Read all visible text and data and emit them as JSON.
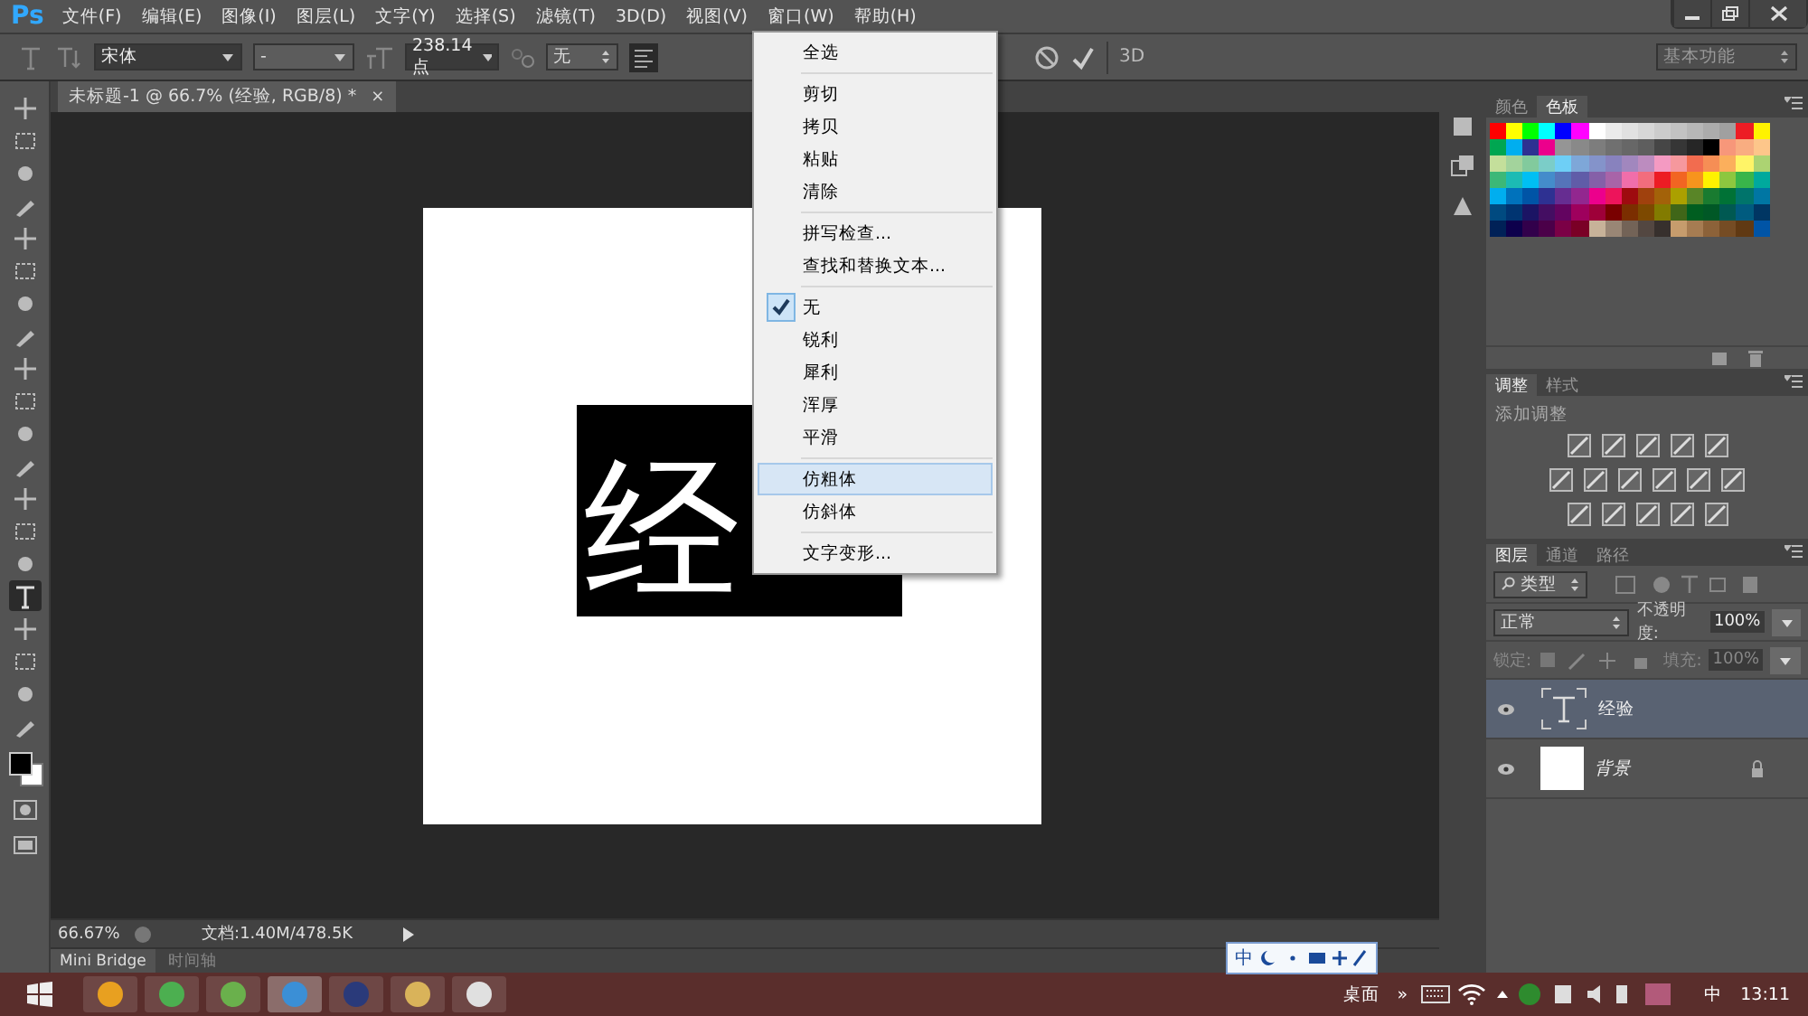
{
  "menubar": {
    "logo": "Ps",
    "items": [
      "文件(F)",
      "编辑(E)",
      "图像(I)",
      "图层(L)",
      "文字(Y)",
      "选择(S)",
      "滤镜(T)",
      "3D(D)",
      "视图(V)",
      "窗口(W)",
      "帮助(H)"
    ]
  },
  "options": {
    "font": "宋体",
    "style": "-",
    "size": "238.14 点",
    "antialias": "无",
    "mode_3d": "3D",
    "workspace": "基本功能"
  },
  "tools": [
    {
      "selected": false
    },
    {
      "selected": false
    },
    {
      "selected": false
    },
    {
      "selected": false
    },
    {
      "selected": false
    },
    {
      "selected": false
    },
    {
      "selected": false
    },
    {
      "selected": false
    },
    {
      "selected": false
    },
    {
      "selected": false
    },
    {
      "selected": false
    },
    {
      "selected": false
    },
    {
      "selected": false
    },
    {
      "selected": false
    },
    {
      "selected": false
    },
    {
      "selected": true
    },
    {
      "selected": false
    },
    {
      "selected": false
    },
    {
      "selected": false
    },
    {
      "selected": false
    }
  ],
  "document": {
    "tab": "未标题-1 @ 66.7% (经验, RGB/8) *",
    "close": "×",
    "text": "经"
  },
  "context_menu": {
    "groups": [
      [
        {
          "label": "全选",
          "checked": false,
          "highlighted": false
        }
      ],
      [
        {
          "label": "剪切",
          "checked": false,
          "highlighted": false
        },
        {
          "label": "拷贝",
          "checked": false,
          "highlighted": false
        },
        {
          "label": "粘贴",
          "checked": false,
          "highlighted": false
        },
        {
          "label": "清除",
          "checked": false,
          "highlighted": false
        }
      ],
      [
        {
          "label": "拼写检查...",
          "checked": false,
          "highlighted": false
        },
        {
          "label": "查找和替换文本...",
          "checked": false,
          "highlighted": false
        }
      ],
      [
        {
          "label": "无",
          "checked": true,
          "highlighted": false
        },
        {
          "label": "锐利",
          "checked": false,
          "highlighted": false
        },
        {
          "label": "犀利",
          "checked": false,
          "highlighted": false
        },
        {
          "label": "浑厚",
          "checked": false,
          "highlighted": false
        },
        {
          "label": "平滑",
          "checked": false,
          "highlighted": false
        }
      ],
      [
        {
          "label": "仿粗体",
          "checked": false,
          "highlighted": true
        },
        {
          "label": "仿斜体",
          "checked": false,
          "highlighted": false
        }
      ],
      [
        {
          "label": "文字变形...",
          "checked": false,
          "highlighted": false
        }
      ]
    ]
  },
  "status": {
    "zoom": "66.67%",
    "doc": "文档:1.40M/478.5K"
  },
  "bottom_tabs": [
    {
      "label": "Mini Bridge",
      "selected": true
    },
    {
      "label": "时间轴",
      "selected": false
    }
  ],
  "swatch_panel": {
    "tabs": [
      {
        "label": "颜色",
        "selected": false
      },
      {
        "label": "色板",
        "selected": true
      }
    ],
    "swatches": [
      {
        "color": "#ff0000"
      },
      {
        "color": "#ffff00"
      },
      {
        "color": "#00ff00"
      },
      {
        "color": "#00ffff"
      },
      {
        "color": "#0000ff"
      },
      {
        "color": "#ff00ff"
      },
      {
        "color": "#ffffff"
      },
      {
        "color": "#ebebeb"
      },
      {
        "color": "#e1e1e1"
      },
      {
        "color": "#d7d7d7"
      },
      {
        "color": "#cccccc"
      },
      {
        "color": "#c2c2c2"
      },
      {
        "color": "#b7b7b7"
      },
      {
        "color": "#acacac"
      },
      {
        "color": "#a0a0a0"
      },
      {
        "color": "#ed1c24"
      },
      {
        "color": "#fff200"
      },
      {
        "color": "#00a651"
      },
      {
        "color": "#00aeef"
      },
      {
        "color": "#2e3192"
      },
      {
        "color": "#ec008c"
      },
      {
        "color": "#959595"
      },
      {
        "color": "#898989"
      },
      {
        "color": "#7d7d7d"
      },
      {
        "color": "#707070"
      },
      {
        "color": "#676767"
      },
      {
        "color": "#5e5e5e"
      },
      {
        "color": "#464646"
      },
      {
        "color": "#363636"
      },
      {
        "color": "#262626"
      },
      {
        "color": "#000000"
      },
      {
        "color": "#f7977a"
      },
      {
        "color": "#f9ad81"
      },
      {
        "color": "#fdc68a"
      },
      {
        "color": "#c4df9b"
      },
      {
        "color": "#a3d39c"
      },
      {
        "color": "#82ca9d"
      },
      {
        "color": "#7bcdc8"
      },
      {
        "color": "#6ecff6"
      },
      {
        "color": "#7ea7d8"
      },
      {
        "color": "#8493ca"
      },
      {
        "color": "#8882be"
      },
      {
        "color": "#a187be"
      },
      {
        "color": "#bc8cbf"
      },
      {
        "color": "#f49ac2"
      },
      {
        "color": "#f6989d"
      },
      {
        "color": "#f26c4f"
      },
      {
        "color": "#f68e55"
      },
      {
        "color": "#fbaf5c"
      },
      {
        "color": "#fff467"
      },
      {
        "color": "#acd372"
      },
      {
        "color": "#3cb878"
      },
      {
        "color": "#1cbbb4"
      },
      {
        "color": "#00bff3"
      },
      {
        "color": "#448ccb"
      },
      {
        "color": "#5574b9"
      },
      {
        "color": "#605ca8"
      },
      {
        "color": "#8560a8"
      },
      {
        "color": "#a864a8"
      },
      {
        "color": "#f06eaa"
      },
      {
        "color": "#f26d7d"
      },
      {
        "color": "#ed1c24"
      },
      {
        "color": "#f26522"
      },
      {
        "color": "#f7941d"
      },
      {
        "color": "#fff200"
      },
      {
        "color": "#8dc73f"
      },
      {
        "color": "#39b54a"
      },
      {
        "color": "#00a99d"
      },
      {
        "color": "#00aeef"
      },
      {
        "color": "#0072bc"
      },
      {
        "color": "#0054a6"
      },
      {
        "color": "#2e3192"
      },
      {
        "color": "#662d91"
      },
      {
        "color": "#92278f"
      },
      {
        "color": "#ec008c"
      },
      {
        "color": "#ed145b"
      },
      {
        "color": "#9e0b0f"
      },
      {
        "color": "#a0410d"
      },
      {
        "color": "#a36209"
      },
      {
        "color": "#aba000"
      },
      {
        "color": "#598527"
      },
      {
        "color": "#197b30"
      },
      {
        "color": "#007236"
      },
      {
        "color": "#00746b"
      },
      {
        "color": "#0076a3"
      },
      {
        "color": "#004a80"
      },
      {
        "color": "#003471"
      },
      {
        "color": "#1b1464"
      },
      {
        "color": "#440e62"
      },
      {
        "color": "#630460"
      },
      {
        "color": "#9e005d"
      },
      {
        "color": "#9e0039"
      },
      {
        "color": "#790000"
      },
      {
        "color": "#7b2e00"
      },
      {
        "color": "#7d4900"
      },
      {
        "color": "#827b00"
      },
      {
        "color": "#406618"
      },
      {
        "color": "#005e20"
      },
      {
        "color": "#005826"
      },
      {
        "color": "#005952"
      },
      {
        "color": "#005b7f"
      },
      {
        "color": "#003663"
      },
      {
        "color": "#002157"
      },
      {
        "color": "#0d004c"
      },
      {
        "color": "#32004b"
      },
      {
        "color": "#4b0049"
      },
      {
        "color": "#7b0046"
      },
      {
        "color": "#7a0026"
      },
      {
        "color": "#c7b299"
      },
      {
        "color": "#998675"
      },
      {
        "color": "#736357"
      },
      {
        "color": "#534741"
      },
      {
        "color": "#37302d"
      },
      {
        "color": "#c69c6d"
      },
      {
        "color": "#a67c52"
      },
      {
        "color": "#8c6239"
      },
      {
        "color": "#754c24"
      },
      {
        "color": "#603913"
      },
      {
        "color": "#0054a6"
      }
    ]
  },
  "adjust_panel": {
    "tabs": [
      {
        "label": "调整",
        "selected": true
      },
      {
        "label": "样式",
        "selected": false
      }
    ],
    "title": "添加调整"
  },
  "layers_panel": {
    "tabs": [
      {
        "label": "图层",
        "selected": true
      },
      {
        "label": "通道",
        "selected": false
      },
      {
        "label": "路径",
        "selected": false
      }
    ],
    "filter": "类型",
    "blend": "正常",
    "opacity_label": "不透明度:",
    "opacity": "100%",
    "lock_label": "锁定:",
    "fill_label": "填充:",
    "fill": "100%",
    "layers": [
      {
        "name": "经验",
        "kind": "text",
        "selected": true,
        "locked": false
      },
      {
        "name": "背景",
        "kind": "background",
        "selected": false,
        "locked": true
      }
    ]
  },
  "ime_bar": {
    "mode": "中"
  },
  "taskbar": {
    "desktop": "桌面",
    "more": "»",
    "ime": "中",
    "time": "13:11"
  }
}
